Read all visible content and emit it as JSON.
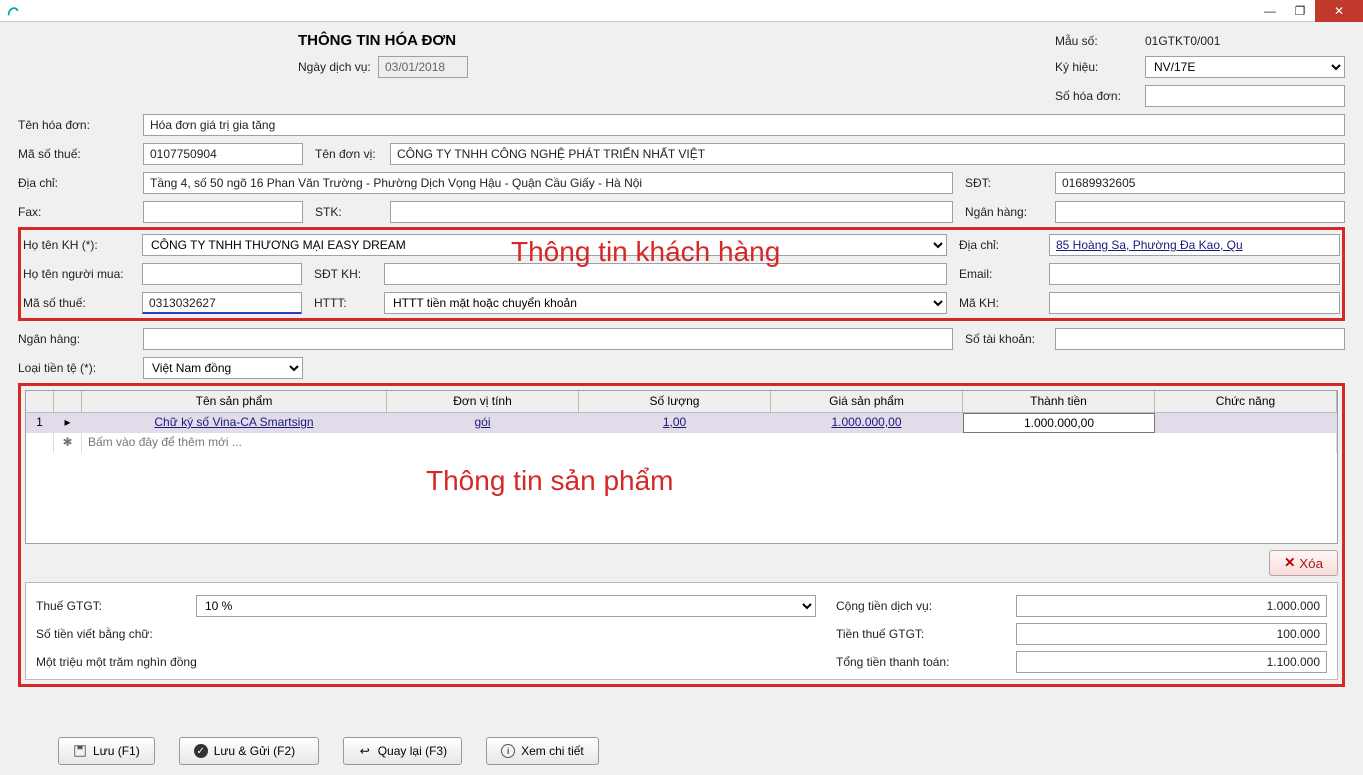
{
  "title": "THÔNG TIN HÓA ĐƠN",
  "labels": {
    "service_date": "Ngày dịch vụ:",
    "template": "Mẫu số:",
    "symbol": "Ký hiệu:",
    "invoice_no": "Số hóa đơn:",
    "invoice_name": "Tên hóa đơn:",
    "tax_code": "Mã số thuế:",
    "company": "Tên đơn vị:",
    "address": "Địa chỉ:",
    "phone": "SĐT:",
    "fax": "Fax:",
    "bank_acc": "STK:",
    "bank": "Ngân hàng:",
    "cust_name": "Họ tên KH (*):",
    "cust_addr": "Địa chỉ:",
    "buyer": "Họ tên người mua:",
    "cust_phone": "SĐT KH:",
    "email": "Email:",
    "cust_tax": "Mã số thuế:",
    "paytype": "HTTT:",
    "cust_code": "Mã KH:",
    "bank2": "Ngân hàng:",
    "acc2": "Số tài khoản:",
    "currency": "Loại tiền tệ (*):",
    "vat": "Thuế GTGT:",
    "in_words": "Số tiền viết bằng chữ:",
    "subtotal": "Cộng tiền dịch vụ:",
    "vat_amount": "Tiền thuế GTGT:",
    "total": "Tổng tiền thanh toán:"
  },
  "values": {
    "service_date": "03/01/2018",
    "template": "01GTKT0/001",
    "symbol": "NV/17E",
    "invoice_no": "",
    "invoice_name": "Hóa đơn giá trị gia tăng",
    "tax_code": "0107750904",
    "company": "CÔNG TY TNHH CÔNG NGHỆ PHÁT TRIỂN NHẤT VIỆT",
    "address": "Tầng 4, số 50 ngõ 16 Phan Văn Trường - Phường Dịch Vọng Hậu - Quận Cầu Giấy - Hà Nội",
    "phone": "01689932605",
    "fax": "",
    "bank_acc": "",
    "bank": "",
    "cust_name": "CÔNG TY TNHH THƯƠNG MẠI EASY DREAM",
    "cust_addr": "85 Hoàng Sa, Phường Đa Kao, Qu",
    "buyer": "",
    "cust_phone": "",
    "email": "",
    "cust_tax": "0313032627",
    "paytype": "HTTT tiền mặt hoặc chuyển khoản",
    "cust_code": "",
    "bank2": "",
    "acc2": "",
    "currency": "Việt Nam đồng",
    "vat": "10 %",
    "in_words": "Một triệu một trăm nghìn đồng",
    "subtotal": "1.000.000",
    "vat_amount": "100.000",
    "total": "1.100.000"
  },
  "grid": {
    "headers": {
      "name": "Tên sản phẩm",
      "unit": "Đơn vị tính",
      "qty": "Số lượng",
      "price": "Giá sản phẩm",
      "amount": "Thành tiền",
      "func": "Chức năng"
    },
    "row_no": "1",
    "row": {
      "name": "Chữ ký số Vina-CA Smartsign",
      "unit": "gói",
      "qty": "1,00",
      "price": "1.000.000,00",
      "amount": "1.000.000,00"
    },
    "new_row": "Bấm vào đây để thêm mới ..."
  },
  "annotations": {
    "customer": "Thông tin khách hàng",
    "product": "Thông tin sản phẩm"
  },
  "buttons": {
    "delete": "Xóa",
    "save": "Lưu (F1)",
    "savesend": "Lưu & Gửi (F2)",
    "back": "Quay lại (F3)",
    "detail": "Xem chi tiết"
  }
}
